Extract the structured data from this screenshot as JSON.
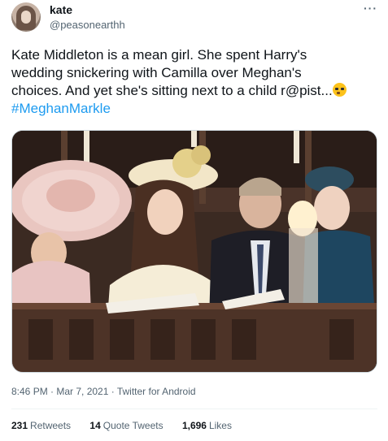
{
  "user": {
    "name": "kate",
    "handle": "@peasonearthh"
  },
  "more_icon": "more-horizontal-icon",
  "tweet": {
    "lines": [
      "Kate Middleton is a mean girl. She spent Harry's",
      "wedding snickering with Camilla over Meghan's",
      "choices. And yet she's sitting next to a child r@pist..."
    ],
    "emoji": "rolling-eyes-emoji",
    "hashtag": "#MeghanMarkle"
  },
  "media": {
    "kind": "photo"
  },
  "meta": {
    "timestamp": "8:46 PM · Mar 7, 2021 · Twitter for Android"
  },
  "stats": [
    {
      "count": "231",
      "label": "Retweets"
    },
    {
      "count": "14",
      "label": "Quote Tweets"
    },
    {
      "count": "1,696",
      "label": "Likes"
    }
  ],
  "colors": {
    "link": "#1d9bf0",
    "secondary_text": "#536471",
    "text": "#0f1419"
  }
}
